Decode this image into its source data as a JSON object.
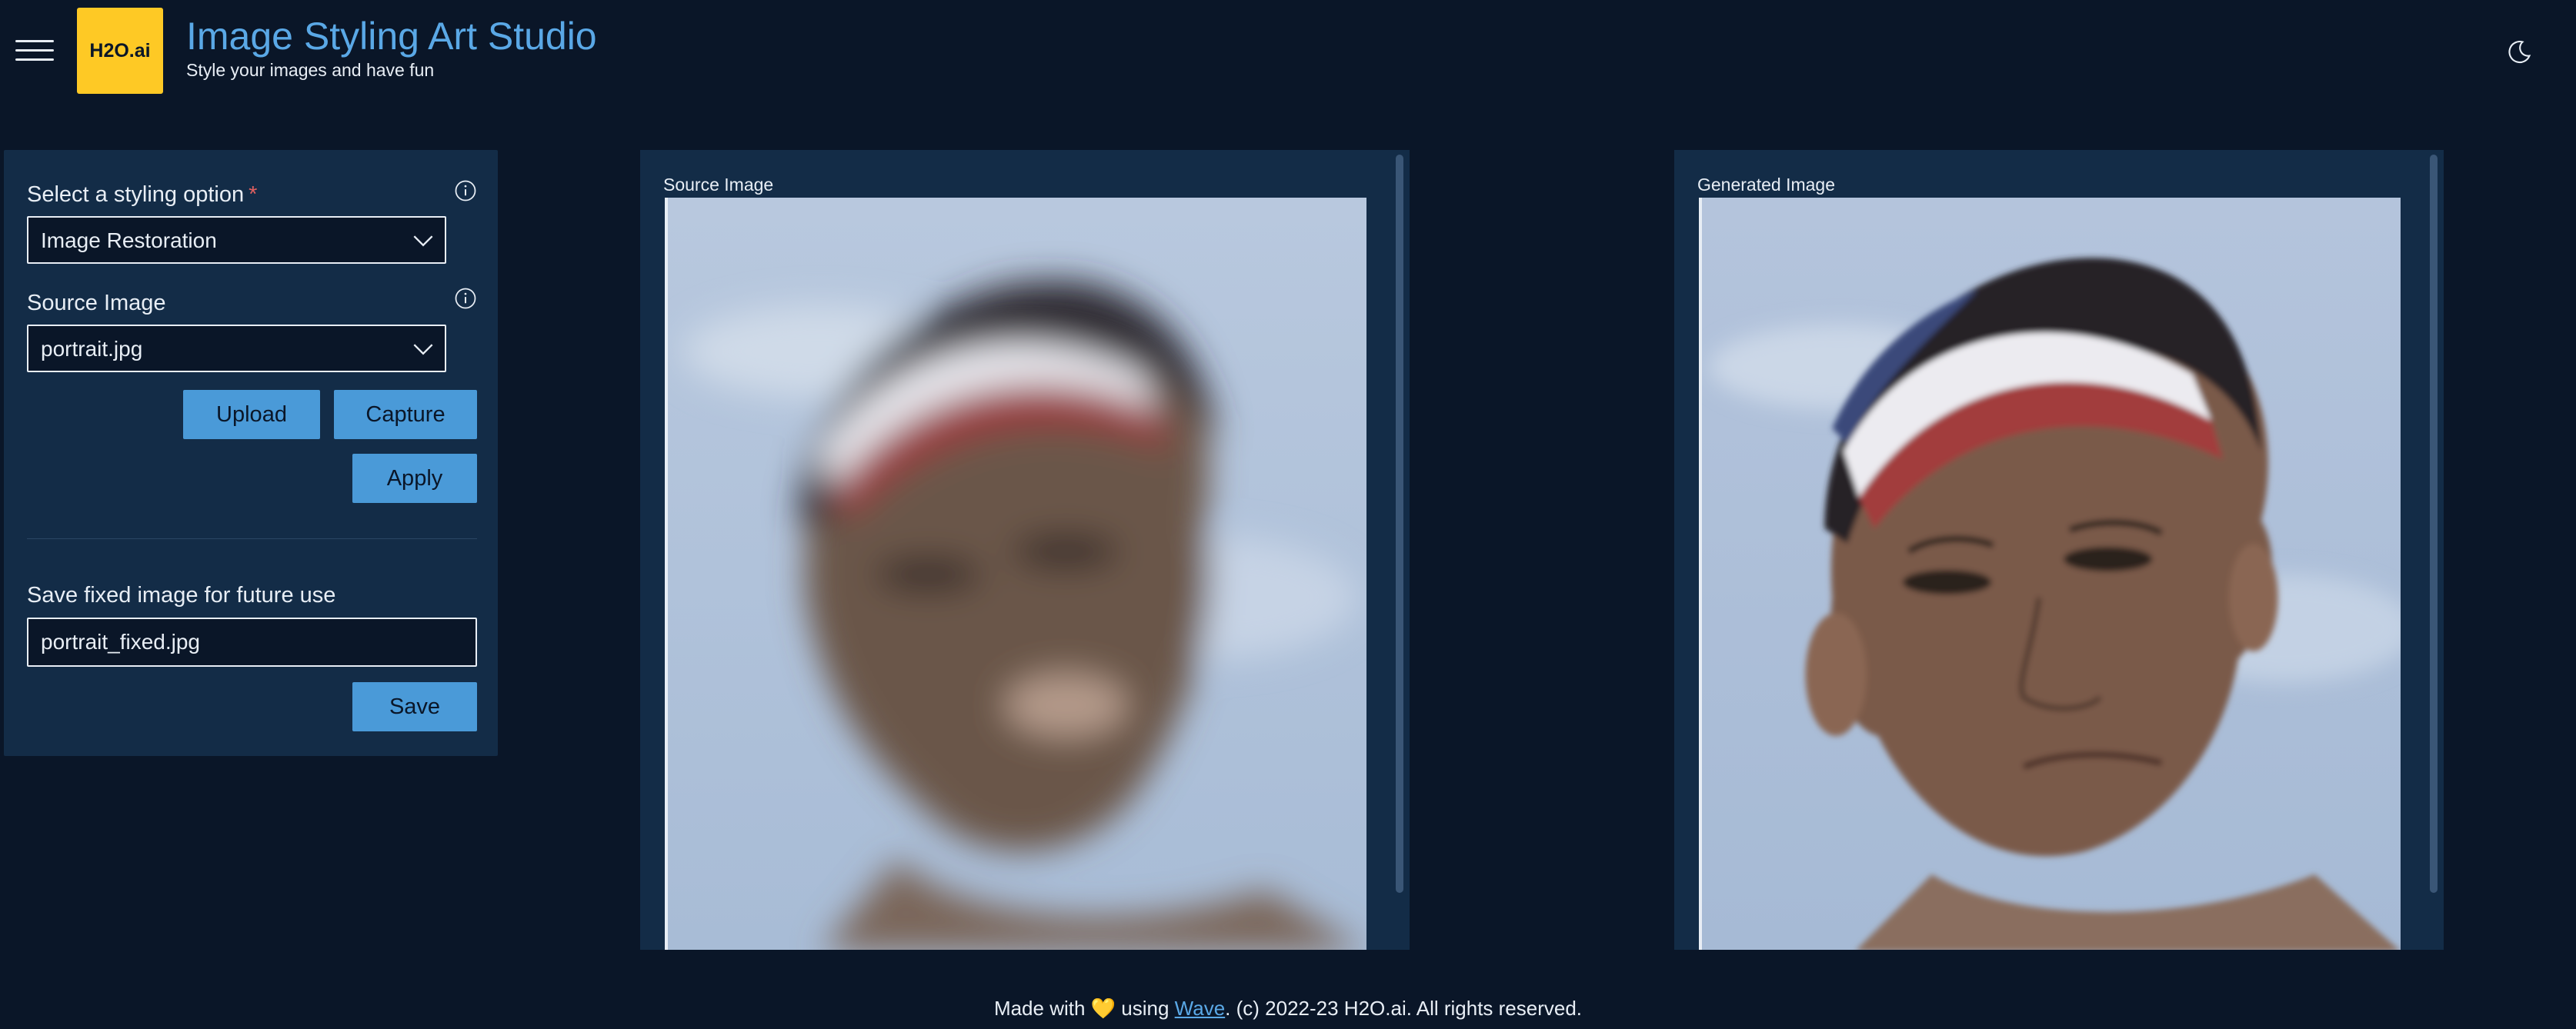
{
  "header": {
    "logo_text": "H2O.ai",
    "title": "Image Styling Art Studio",
    "subtitle": "Style your images and have fun",
    "menu_icon": "hamburger-icon",
    "theme_icon": "moon-icon"
  },
  "sidebar": {
    "styling_label": "Select a styling option",
    "styling_required": "*",
    "styling_value": "Image Restoration",
    "source_label": "Source Image",
    "source_value": "portrait.jpg",
    "upload_label": "Upload",
    "capture_label": "Capture",
    "apply_label": "Apply",
    "save_section_label": "Save fixed image for future use",
    "save_filename": "portrait_fixed.jpg",
    "save_label": "Save"
  },
  "source_card": {
    "title": "Source Image"
  },
  "generated_card": {
    "title": "Generated Image"
  },
  "footer": {
    "prefix": "Made with",
    "heart": "💛",
    "using": "using",
    "link": "Wave",
    "suffix": ". (c) 2022-23 H2O.ai. All rights reserved."
  },
  "colors": {
    "background": "#0a1628",
    "card": "#132c47",
    "accent": "#5aa8e6",
    "button": "#4a9ad8",
    "logo": "#fec925"
  }
}
